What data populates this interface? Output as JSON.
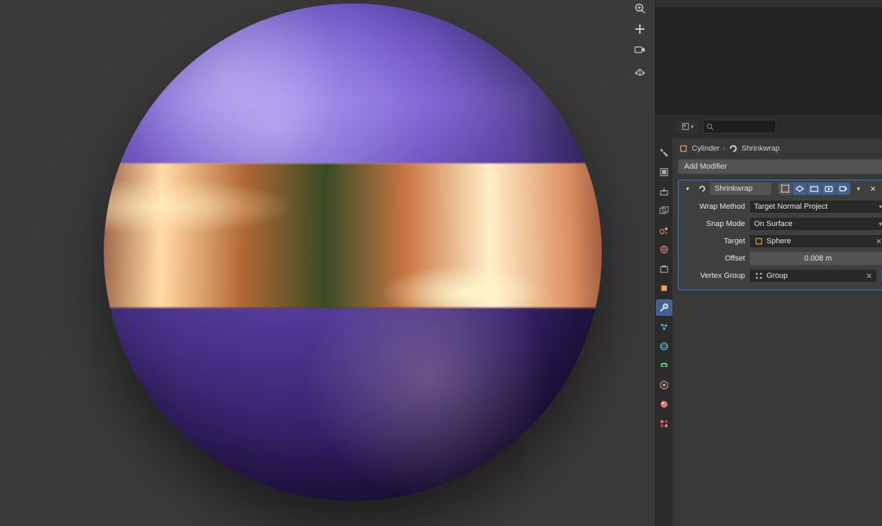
{
  "viewport_tools": [
    "zoom",
    "move",
    "camera",
    "grid"
  ],
  "breadcrumb": {
    "object_label": "Cylinder",
    "modifier_label": "Shrinkwrap"
  },
  "add_modifier_label": "Add Modifier",
  "modifier": {
    "name": "Shrinkwrap",
    "toggles": {
      "edit_cage": false,
      "on_cage": true,
      "edit_mode": true,
      "realtime": true,
      "render": true
    },
    "wrap_method": {
      "label": "Wrap Method",
      "value": "Target Normal Project"
    },
    "snap_mode": {
      "label": "Snap Mode",
      "value": "On Surface"
    },
    "target": {
      "label": "Target",
      "value": "Sphere"
    },
    "offset": {
      "label": "Offset",
      "value": "0.008 m"
    },
    "vertex_group": {
      "label": "Vertex Group",
      "value": "Group"
    }
  },
  "property_tabs": [
    "tool",
    "render",
    "output",
    "viewlayer",
    "scene",
    "world",
    "collection",
    "object",
    "modifiers",
    "particles",
    "physics",
    "constraints",
    "data",
    "material",
    "texture"
  ],
  "active_tab": "modifiers"
}
